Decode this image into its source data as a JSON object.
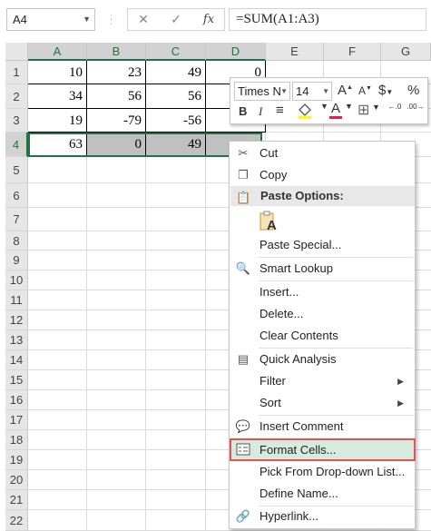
{
  "formula_bar": {
    "name_box": "A4",
    "cancel_glyph": "✕",
    "enter_glyph": "✓",
    "fx_label": "fx",
    "formula": "=SUM(A1:A3)"
  },
  "columns": [
    "A",
    "B",
    "C",
    "D",
    "E",
    "F",
    "G"
  ],
  "rows": [
    "1",
    "2",
    "3",
    "4",
    "5",
    "6",
    "7",
    "8",
    "9",
    "10",
    "11",
    "12",
    "13",
    "14",
    "15",
    "16",
    "17",
    "18",
    "19",
    "20",
    "21",
    "22"
  ],
  "cells": {
    "r1": [
      "10",
      "23",
      "49",
      "0"
    ],
    "r2": [
      "34",
      "56",
      "56",
      ""
    ],
    "r3": [
      "19",
      "-79",
      "-56",
      ""
    ],
    "r4": [
      "63",
      "0",
      "49",
      ""
    ]
  },
  "mini_toolbar": {
    "font_name": "Times N",
    "font_size": "14",
    "grow_font": "A",
    "shrink_font": "A",
    "currency": "$",
    "percent": "%",
    "comma": ",",
    "bold": "B",
    "italic": "I",
    "align": "≡",
    "fill_color": "#ffff00",
    "font_color_letter": "A",
    "font_color": "#e8175d",
    "border_glyph": "⊞",
    "inc_decimal": "←.0",
    "dec_decimal": ".00→"
  },
  "context_menu": {
    "cut": "Cut",
    "copy": "Copy",
    "paste_options": "Paste Options:",
    "paste_icon_letter": "A",
    "paste_special": "Paste Special...",
    "smart_lookup": "Smart Lookup",
    "insert": "Insert...",
    "delete": "Delete...",
    "clear_contents": "Clear Contents",
    "quick_analysis": "Quick Analysis",
    "filter": "Filter",
    "sort": "Sort",
    "insert_comment": "Insert Comment",
    "format_cells": "Format Cells...",
    "pick_from_list": "Pick From Drop-down List...",
    "define_name": "Define Name...",
    "hyperlink": "Hyperlink...",
    "submenu_arrow": "▶"
  },
  "colors": {
    "excel_green": "#217346",
    "highlight_fill": "#d6ebde",
    "highlight_border": "#e25454",
    "selected_cells": "#c0c0c0"
  }
}
